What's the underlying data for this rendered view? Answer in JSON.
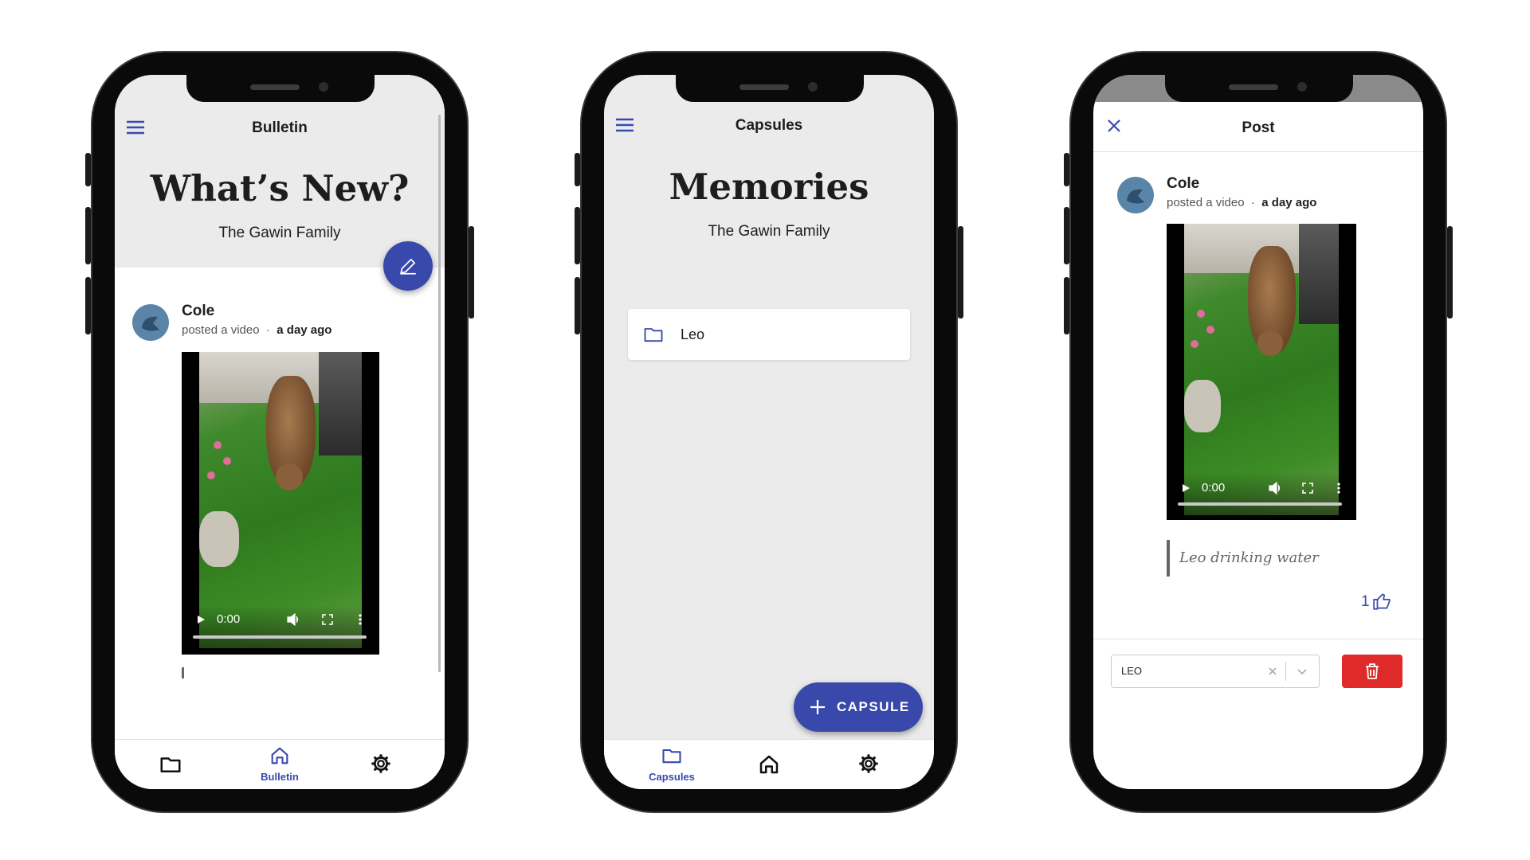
{
  "bulletin_screen": {
    "header_title": "Bulletin",
    "hero_title": "What’s New?",
    "hero_subtitle": "The Gawin Family",
    "post": {
      "author": "Cole",
      "action": "posted a video",
      "separator": "·",
      "time": "a day ago",
      "video_time": "0:00"
    },
    "nav": {
      "capsules_icon": "folder-icon",
      "bulletin_label": "Bulletin",
      "settings_icon": "gear-icon"
    },
    "fab_icon": "pencil-icon"
  },
  "capsules_screen": {
    "header_title": "Capsules",
    "hero_title": "Memories",
    "hero_subtitle": "The Gawin Family",
    "capsules": [
      {
        "name": "Leo",
        "icon": "folder-icon"
      }
    ],
    "add_button_label": "CAPSULE",
    "nav": {
      "capsules_label": "Capsules",
      "home_icon": "home-icon",
      "settings_icon": "gear-icon"
    }
  },
  "post_screen": {
    "header_title": "Post",
    "post": {
      "author": "Cole",
      "action": "posted a video",
      "separator": "·",
      "time": "a day ago",
      "video_time": "0:00",
      "caption": "Leo drinking water",
      "likes": "1"
    },
    "capsule_select_value": "LEO",
    "delete_icon": "trash-icon"
  },
  "colors": {
    "accent": "#3949ab",
    "danger": "#e02a2a",
    "header_bg": "#ebebeb"
  }
}
